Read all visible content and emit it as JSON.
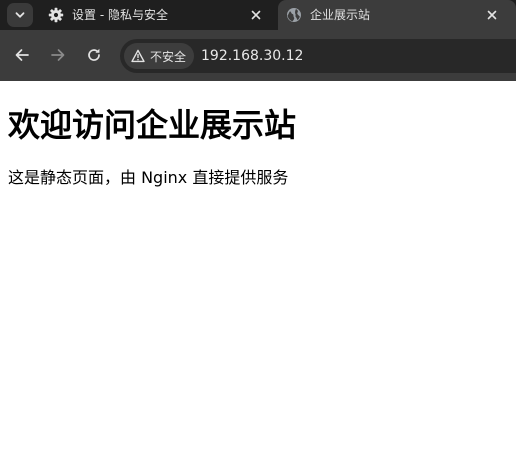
{
  "tabs": [
    {
      "title": "设置 - 隐私与安全",
      "icon": "gear-icon",
      "active": false
    },
    {
      "title": "企业展示站",
      "icon": "globe-icon",
      "active": true
    }
  ],
  "toolbar": {
    "security_label": "不安全",
    "security_icon": "warning-icon",
    "url": "192.168.30.12"
  },
  "page": {
    "heading": "欢迎访问企业展示站",
    "description": "这是静态页面，由 Nginx 直接提供服务"
  },
  "colors": {
    "tabstrip_bg": "#1f1f1f",
    "toolbar_bg": "#3c3c3c",
    "omnibox_bg": "#282828",
    "text_light": "#e3e3e3",
    "page_bg": "#ffffff"
  }
}
